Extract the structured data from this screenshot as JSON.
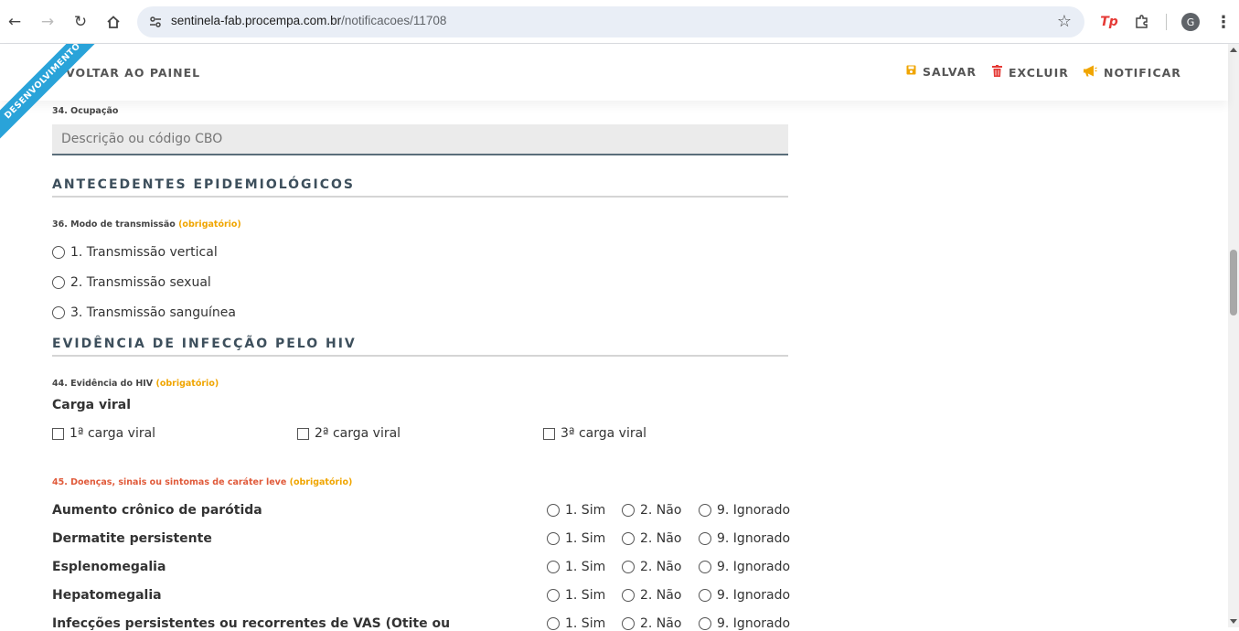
{
  "browser": {
    "url_host": "sentinela-fab.procempa.com.br",
    "url_path": "/notificacoes/11708",
    "avatar_letter": "G",
    "ext_tp": "Tp"
  },
  "header": {
    "ribbon": "DESENVOLVIMENTO",
    "back": "VOLTAR AO PAINEL",
    "save": "SALVAR",
    "delete": "EXCLUIR",
    "notify": "NOTIFICAR"
  },
  "occupation": {
    "label": "34. Ocupação",
    "placeholder": "Descrição ou código CBO"
  },
  "sections": {
    "epi": "ANTECEDENTES EPIDEMIOLÓGICOS",
    "hiv": "EVIDÊNCIA DE INFECÇÃO PELO HIV"
  },
  "transmission": {
    "label": "36. Modo de transmissão",
    "required": "(obrigatório)",
    "options": [
      "1. Transmissão vertical",
      "2. Transmissão sexual",
      "3. Transmissão sanguínea"
    ]
  },
  "evidence": {
    "label": "44. Evidência do HIV",
    "required": "(obrigatório)",
    "subtitle": "Carga viral",
    "checks": [
      "1ª carga viral",
      "2ª carga viral",
      "3ª carga viral"
    ]
  },
  "diseases": {
    "label": "45. Doenças, sinais ou sintomas de caráter leve",
    "required": "(obrigatório)",
    "options": [
      "1. Sim",
      "2. Não",
      "9. Ignorado"
    ],
    "rows": [
      "Aumento crônico de parótida",
      "Dermatite persistente",
      "Esplenomegalia",
      "Hepatomegalia",
      "Infecções persistentes ou recorrentes de VAS (Otite ou"
    ]
  },
  "colors": {
    "accent": "#29a3d9",
    "required": "#f0a500",
    "danger": "#e53935",
    "section": "#3d4f5c"
  }
}
